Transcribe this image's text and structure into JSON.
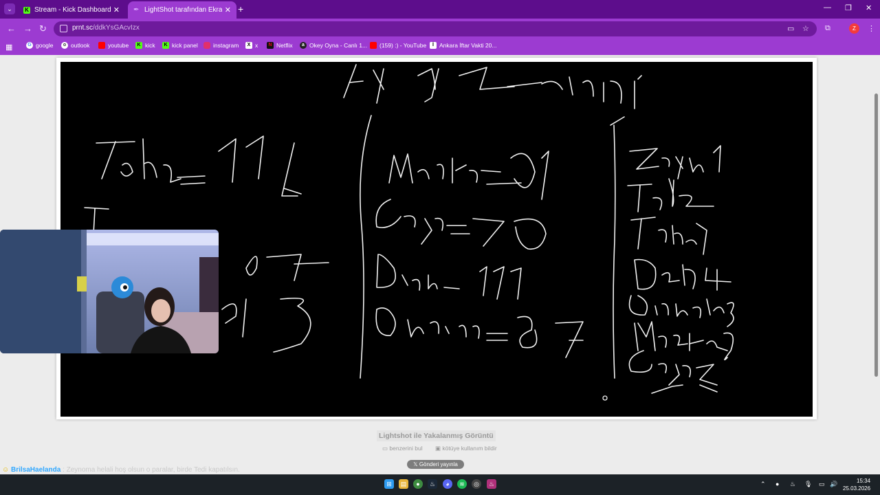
{
  "browser": {
    "tabs": [
      {
        "label": "Stream - Kick Dashboard",
        "active": false
      },
      {
        "label": "LightShot tarafından Ekran Görü",
        "active": true
      }
    ],
    "url_domain": "prnt.sc",
    "url_path": "/ddkYsGAcvIzx",
    "bookmarks": [
      {
        "label": "google",
        "icon": "google-icon"
      },
      {
        "label": "outlook",
        "icon": "outlook-icon"
      },
      {
        "label": "youtube",
        "icon": "youtube-icon"
      },
      {
        "label": "kick",
        "icon": "kick-icon"
      },
      {
        "label": "kick panel",
        "icon": "kick-icon"
      },
      {
        "label": "instagram",
        "icon": "instagram-icon"
      },
      {
        "label": "x",
        "icon": "x-icon"
      },
      {
        "label": "Netflix",
        "icon": "netflix-icon"
      },
      {
        "label": "Okey Oyna - Canlı 1...",
        "icon": "okey-icon"
      },
      {
        "label": "(159) :) - YouTube",
        "icon": "youtube-icon"
      },
      {
        "label": "Ankara İftar Vakti 20...",
        "icon": "iftar-icon"
      }
    ],
    "profile_initial": "Z"
  },
  "page": {
    "caption": "Lightshot ile Yakalanmış Görüntü",
    "similar_link": "benzerini bul",
    "report_link": "kötüye kullanım bildir",
    "tweet_button": "Gönderi yayınla"
  },
  "chat": {
    "username": "BrilsaHaelanda",
    "message": ": Zeynoma helali hoş olsun o paralar, birde Tedi kapatılsın."
  },
  "taskbar": {
    "time": "15:34",
    "date": "25.03.2026"
  },
  "colors": {
    "tab_bar": "#5d0d8c",
    "toolbar": "#9c3bd1",
    "kick_green": "#53fc18"
  }
}
